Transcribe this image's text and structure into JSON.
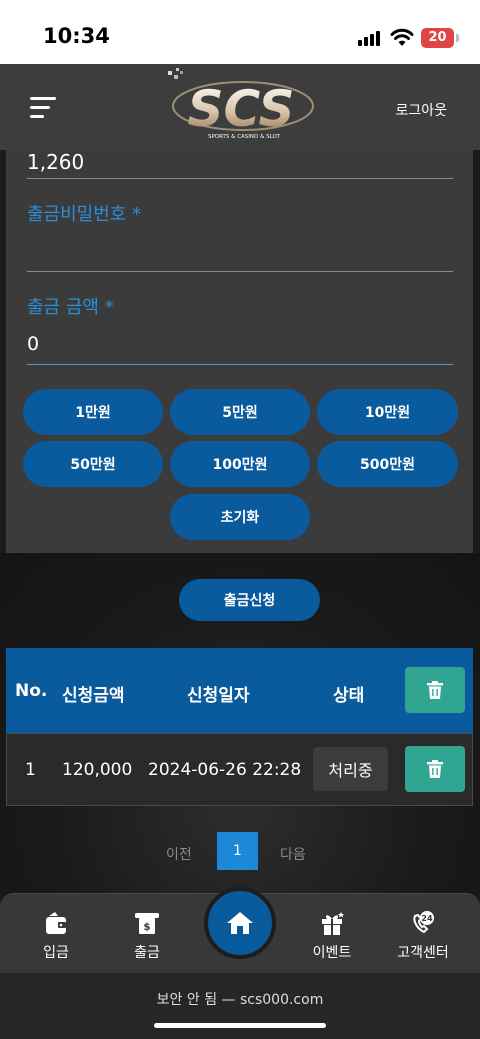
{
  "status_bar": {
    "time": "10:34",
    "battery": "20"
  },
  "header": {
    "logo_text": "SCS",
    "logo_tagline": "SPORTS & CASINO & SLOT",
    "logout_label": "로그아웃"
  },
  "form": {
    "balance_value": "1,260",
    "password_label": "출금비밀번호 *",
    "password_value": "",
    "amount_label": "출금 금액 *",
    "amount_value": "0",
    "amount_buttons": [
      "1만원",
      "5만원",
      "10만원",
      "50만원",
      "100만원",
      "500만원"
    ],
    "reset_label": "초기화"
  },
  "submit_label": "출금신청",
  "table": {
    "headers": [
      "No.",
      "신청금액",
      "신청일자",
      "상태"
    ],
    "rows": [
      {
        "no": "1",
        "amount": "120,000",
        "date": "2024-06-26 22:28",
        "status": "처리중"
      }
    ]
  },
  "pagination": {
    "prev": "이전",
    "current": "1",
    "next": "다음"
  },
  "bottom_nav": {
    "items": [
      "입금",
      "출금",
      "이벤트",
      "고객센터"
    ]
  },
  "browser": {
    "url": "보안 안 됨 — scs000.com"
  },
  "colors": {
    "accent": "#0a5a9e",
    "label_blue": "#2a8fd8",
    "trash_teal": "#2fa592",
    "panel": "#3b3b3b"
  }
}
